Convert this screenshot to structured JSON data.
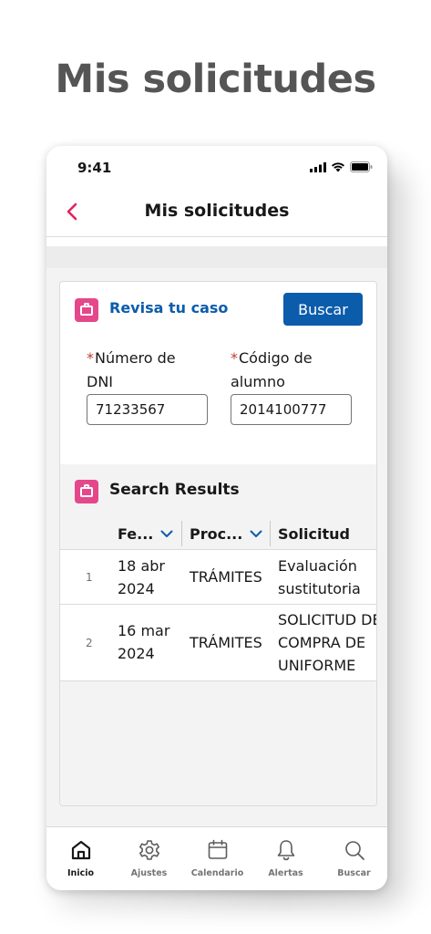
{
  "hero": {
    "title": "Mis solicitudes"
  },
  "status": {
    "time": "9:41"
  },
  "nav": {
    "title": "Mis solicitudes"
  },
  "search_card": {
    "title": "Revisa tu caso",
    "button_label": "Buscar",
    "dni": {
      "required_mark": "*",
      "label_line1": "Número de",
      "label_line2": "DNI",
      "value": "71233567"
    },
    "codigo": {
      "required_mark": "*",
      "label_line1": "Código de",
      "label_line2": "alumno",
      "value": "2014100777"
    }
  },
  "results": {
    "title": "Search Results",
    "columns": [
      "Fe...",
      "Proc...",
      "Solicitud"
    ],
    "rows": [
      {
        "num": "1",
        "fecha": [
          "18 abr",
          "2024"
        ],
        "proceso": "TRÁMITES",
        "solicitud": [
          "Evaluación",
          "sustitutoria"
        ]
      },
      {
        "num": "2",
        "fecha": [
          "16 mar",
          "2024"
        ],
        "proceso": "TRÁMITES",
        "solicitud": [
          "SOLICITUD DE",
          "COMPRA DE",
          "UNIFORME"
        ]
      }
    ]
  },
  "tabs": [
    {
      "label": "Inicio",
      "icon": "home-icon",
      "active": true
    },
    {
      "label": "Ajustes",
      "icon": "gear-icon",
      "active": false
    },
    {
      "label": "Calendario",
      "icon": "calendar-icon",
      "active": false
    },
    {
      "label": "Alertas",
      "icon": "bell-icon",
      "active": false
    },
    {
      "label": "Buscar",
      "icon": "search-icon",
      "active": false
    }
  ],
  "colors": {
    "accent": "#0b5cab",
    "icon_pink": "#e4488a",
    "back_arrow": "#e0245e",
    "required": "#c23934"
  }
}
